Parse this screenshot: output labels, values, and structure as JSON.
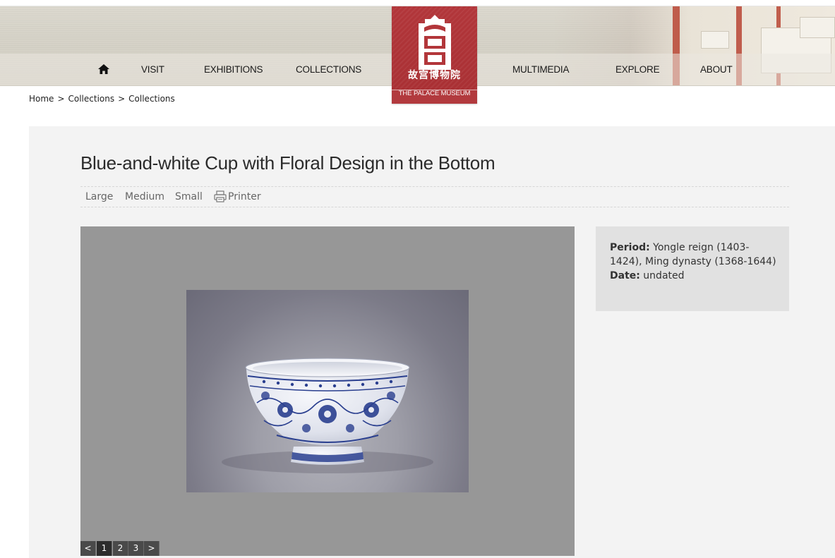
{
  "header": {
    "logo_cn": "故宫博物院",
    "logo_caption": "THE PALACE MUSEUM",
    "nav": {
      "visit": "VISIT",
      "exhibitions": "EXHIBITIONS",
      "collections": "COLLECTIONS",
      "multimedia": "MULTIMEDIA",
      "explore": "EXPLORE",
      "about": "ABOUT"
    },
    "icons": {
      "home": "home-icon",
      "logo": "palace-museum-logo"
    }
  },
  "breadcrumb": {
    "items": [
      "Home",
      "Collections",
      "Collections"
    ],
    "separator": ">"
  },
  "artifact": {
    "title": "Blue-and-white Cup with Floral Design in the Bottom",
    "tools": {
      "large": "Large",
      "medium": "Medium",
      "small": "Small",
      "printer": "Printer",
      "printer_icon": "printer-icon"
    },
    "viewer": {
      "pager_prev": "<",
      "pages": [
        "1",
        "2",
        "3"
      ],
      "active_page": "1",
      "pager_next": ">"
    },
    "info": {
      "period_label": "Period:",
      "period_value": " Yongle reign (1403-1424), Ming dynasty (1368-1644)",
      "date_label": "Date:",
      "date_value": " undated"
    }
  },
  "colors": {
    "logo_red": "#b2363a",
    "panel_bg": "#f3f3f3",
    "viewer_bg": "#979797",
    "info_bg": "#e1e1e1",
    "porcelain_blue": "#2a3f8f"
  }
}
